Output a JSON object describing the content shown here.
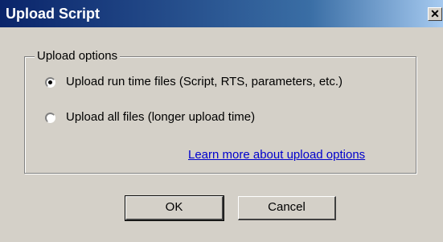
{
  "window": {
    "title": "Upload Script",
    "close_glyph": "✕",
    "close_icon": "close-icon"
  },
  "upload_options": {
    "legend": "Upload options",
    "options": [
      {
        "label": "Upload run time files (Script, RTS, parameters, etc.)",
        "selected": true
      },
      {
        "label": "Upload all files (longer upload time)",
        "selected": false
      }
    ],
    "learn_more_link": "Learn more about upload options "
  },
  "buttons": {
    "ok_label": "OK",
    "cancel_label": "Cancel"
  },
  "colors": {
    "title_bar_start": "#0a246a",
    "title_bar_end": "#a6caf0",
    "face": "#d4d0c8",
    "link": "#0000cc"
  }
}
